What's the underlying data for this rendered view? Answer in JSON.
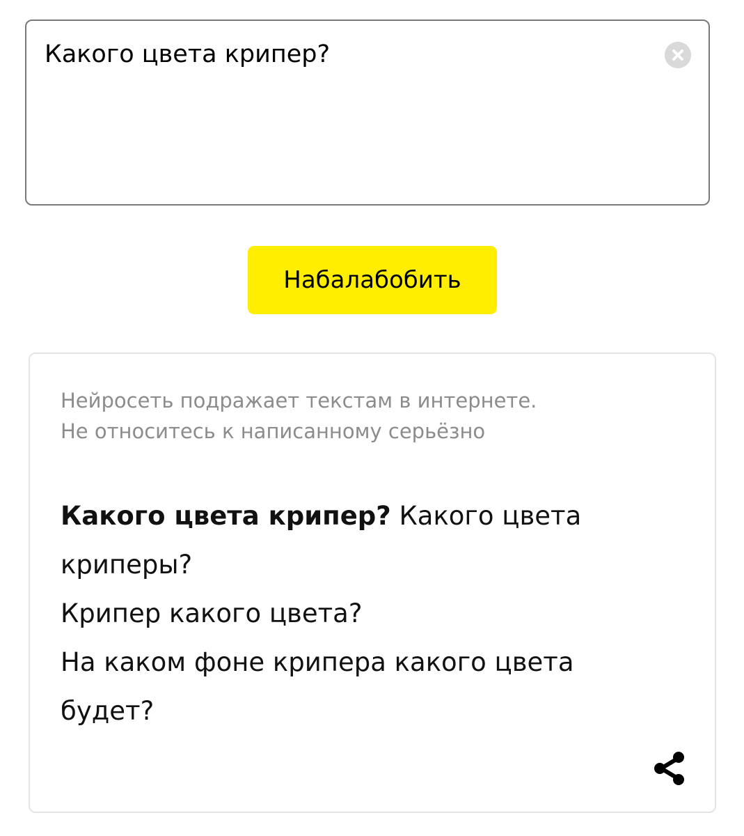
{
  "input": {
    "value": "Какого цвета крипер?",
    "clear_icon": "clear-circle-x-icon"
  },
  "generate_button": {
    "label": "Набалабобить",
    "color": "#ffee00"
  },
  "result": {
    "disclaimer_line1": "Нейросеть подражает текстам в интернете.",
    "disclaimer_line2": "Не относитесь к написанному серьёзно",
    "prompt_bold": "Какого цвета крипер?",
    "continuation_first": "Какого цвета криперы?",
    "continuation_lines": [
      "Крипер какого цвета?",
      "На каком фоне крипера какого цвета будет?"
    ],
    "share_icon": "share-icon"
  }
}
